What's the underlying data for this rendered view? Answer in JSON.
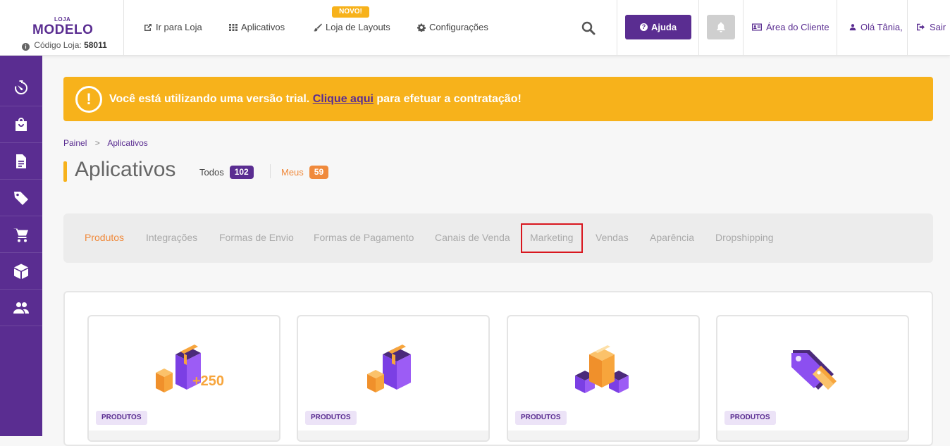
{
  "header": {
    "logo_small": "LOJA",
    "logo_big": "MODELO",
    "store_code_label": "Código Loja:",
    "store_code_value": "58011",
    "nav": {
      "store": "Ir para Loja",
      "apps": "Aplicativos",
      "layouts": "Loja de Layouts",
      "layouts_badge": "NOVO!",
      "settings": "Configurações"
    },
    "help": "Ajuda",
    "client_area": "Área do Cliente",
    "greeting": "Olá Tânia,",
    "logout": "Sair"
  },
  "sidebar": {
    "items": [
      "dashboard-icon",
      "bag-icon",
      "document-icon",
      "tag-icon",
      "cart-icon",
      "box-icon",
      "users-icon"
    ]
  },
  "trial": {
    "icon": "!",
    "text_before": "Você está utilizando uma versão trial.",
    "link": "Clique aqui",
    "text_after": "para efetuar a contratação!"
  },
  "breadcrumb": {
    "home": "Painel",
    "separator": ">",
    "current": "Aplicativos"
  },
  "page": {
    "title": "Aplicativos",
    "filters": {
      "all_label": "Todos",
      "all_count": "102",
      "mine_label": "Meus",
      "mine_count": "59"
    }
  },
  "tabs": [
    "Produtos",
    "Integrações",
    "Formas de Envio",
    "Formas de Pagamento",
    "Canais de Venda",
    "Marketing",
    "Vendas",
    "Aparência",
    "Dropshipping"
  ],
  "active_tab": "Produtos",
  "highlighted_tab": "Marketing",
  "cards": [
    {
      "tag": "PRODUTOS",
      "image_text": "+250",
      "icon": "boxes-plus-icon"
    },
    {
      "tag": "PRODUTOS",
      "icon": "boxes-icon"
    },
    {
      "tag": "PRODUTOS",
      "icon": "box-stack-icon"
    },
    {
      "tag": "PRODUTOS",
      "icon": "price-tag-icon"
    }
  ],
  "colors": {
    "brand": "#5a2d91",
    "accent": "#f7b21b",
    "orange": "#f08a3c",
    "highlight": "#d8161e"
  }
}
